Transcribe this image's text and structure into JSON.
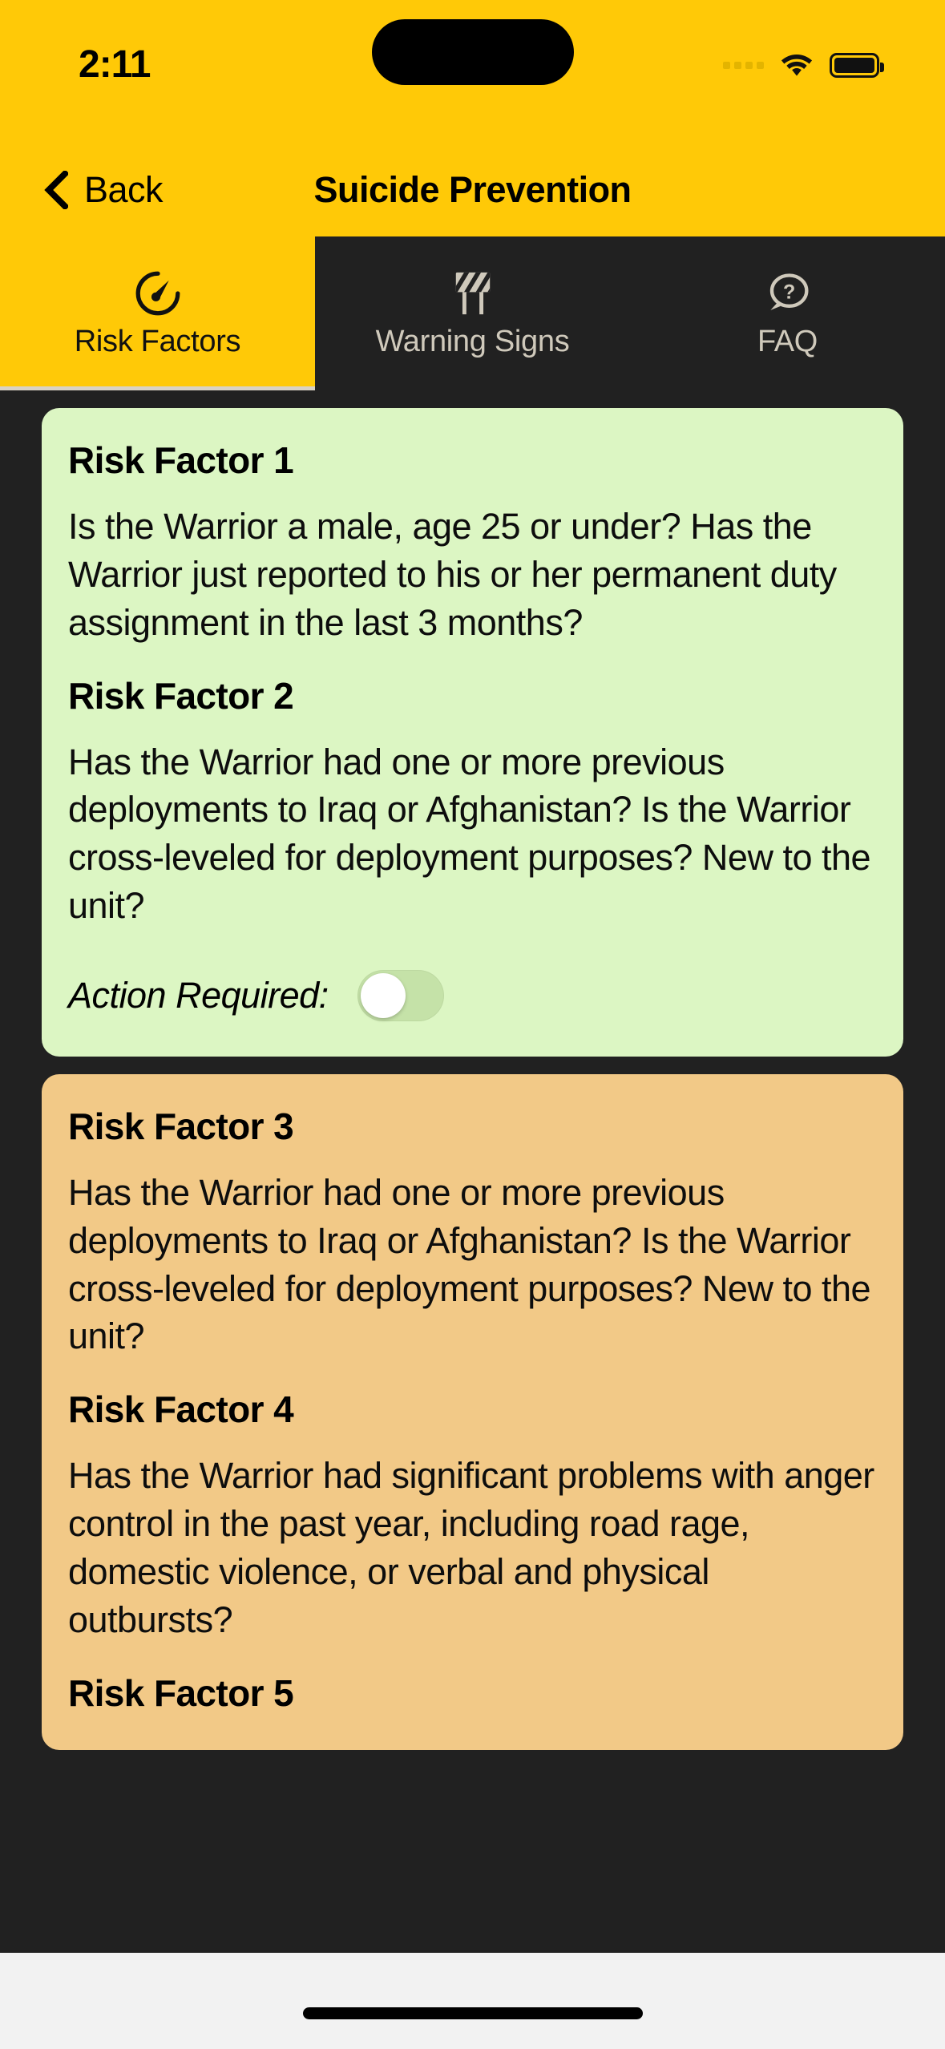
{
  "status_bar": {
    "time": "2:11",
    "cellular_icon": "cellular-dots-icon",
    "wifi_icon": "wifi-icon",
    "battery_icon": "battery-full-icon"
  },
  "nav": {
    "back_label": "Back",
    "back_icon": "chevron-left-icon",
    "title": "Suicide Prevention",
    "bar_color": "#FFC907"
  },
  "tabs": [
    {
      "label": "Risk Factors",
      "icon": "gauge-icon",
      "active": true
    },
    {
      "label": "Warning Signs",
      "icon": "barrier-icon",
      "active": false
    },
    {
      "label": "FAQ",
      "icon": "question-bubble-icon",
      "active": false
    }
  ],
  "cards": [
    {
      "color": "#DCF6C3",
      "items": [
        {
          "title": "Risk Factor 1",
          "body": "Is the Warrior a male, age 25 or under? Has the Warrior just reported to his or her permanent duty assignment in the last 3 months?"
        },
        {
          "title": "Risk Factor 2",
          "body": "Has the Warrior had one or more previous deployments to Iraq or Afghanistan? Is the Warrior cross-leveled for deployment purposes? New to the unit?"
        }
      ],
      "action": {
        "label": "Action Required:",
        "toggle_on": false
      }
    },
    {
      "color": "#F2C987",
      "items": [
        {
          "title": "Risk Factor 3",
          "body": "Has the Warrior had one or more previous deployments to Iraq or Afghanistan? Is the Warrior cross-leveled for deployment purposes? New to the unit?"
        },
        {
          "title": "Risk Factor 4",
          "body": "Has the Warrior had significant problems with anger control in the past year, including road rage, domestic violence, or verbal and physical outbursts?"
        },
        {
          "title": "Risk Factor 5",
          "body": ""
        }
      ]
    }
  ]
}
